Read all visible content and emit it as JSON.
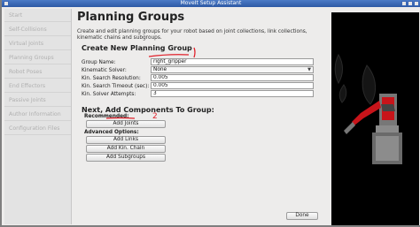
{
  "window": {
    "title": "MoveIt Setup Assistant"
  },
  "sidebar": {
    "items": [
      {
        "label": "Start"
      },
      {
        "label": "Self-Collisions"
      },
      {
        "label": "Virtual Joints"
      },
      {
        "label": "Planning Groups"
      },
      {
        "label": "Robot Poses"
      },
      {
        "label": "End Effectors"
      },
      {
        "label": "Passive Joints"
      },
      {
        "label": "Author Information"
      },
      {
        "label": "Configuration Files"
      }
    ]
  },
  "main": {
    "title": "Planning Groups",
    "description": "Create and edit planning groups for your robot based on joint collections, link collections, kinematic chains and subgroups.",
    "create_section": {
      "title": "Create New Planning Group",
      "fields": [
        {
          "label": "Group Name:",
          "value": "right_gripper"
        },
        {
          "label": "Kinematic Solver:",
          "value": "None"
        },
        {
          "label": "Kin. Search Resolution:",
          "value": "0.005"
        },
        {
          "label": "Kin. Search Timeout (sec):",
          "value": "0.005"
        },
        {
          "label": "Kin. Solver Attempts:",
          "value": "3"
        }
      ]
    },
    "components_section": {
      "title": "Next, Add Components To Group:",
      "recommended_label": "Recommended:",
      "add_joints_label": "Add Joints",
      "advanced_label": "Advanced Options:",
      "add_links_label": "Add Links",
      "add_kin_chain_label": "Add Kin. Chain",
      "add_subgroups_label": "Add Subgroups"
    },
    "done_label": "Done"
  },
  "colors": {
    "titlebar": "#2d5aa5",
    "viewer_background": "#000000",
    "robot_red": "#c8141a",
    "annotation_red": "#e0202a"
  },
  "annotations": {
    "joints_mark": "2"
  }
}
